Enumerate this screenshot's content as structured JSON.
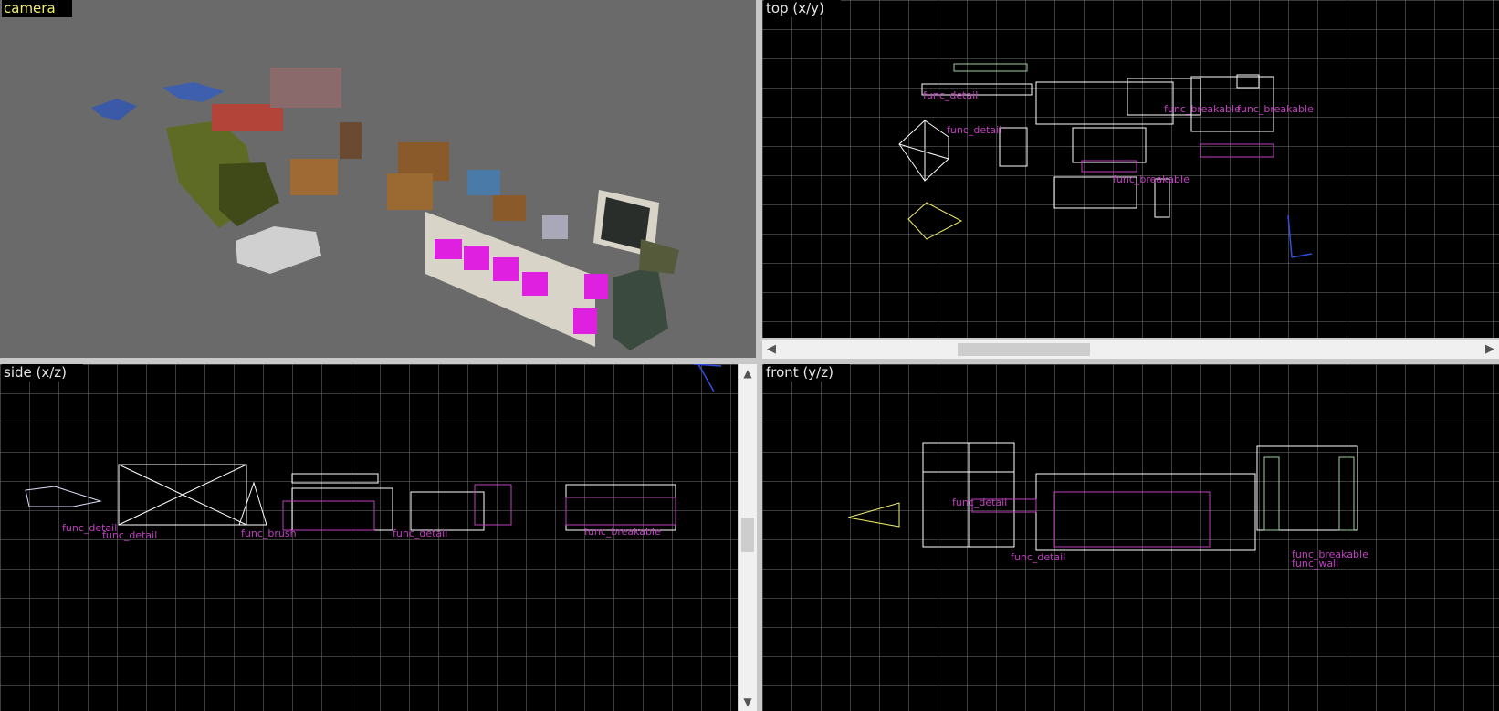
{
  "viewports": {
    "camera": {
      "label": "camera"
    },
    "top": {
      "label": "top (x/y)"
    },
    "side": {
      "label": "side (x/z)"
    },
    "front": {
      "label": "front (y/z)"
    }
  },
  "entity_labels": {
    "top": [
      "func_detail",
      "func_breakable",
      "func_detail",
      "func_breakable",
      "func_breakable"
    ],
    "side": [
      "func_detail",
      "func_detail",
      "func_brush",
      "func_detail",
      "func_breakable"
    ],
    "front": [
      "func_detail",
      "func_detail",
      "func_breakable",
      "func_wall"
    ]
  },
  "colors": {
    "camera_bg": "#6a6a6a",
    "grid_bg": "#000000",
    "grid_line": "#6e6e6e",
    "brush_white": "#ffffff",
    "entity_magenta": "#c040c0",
    "label_yellow": "#f2ef6a"
  },
  "icons": {
    "scroll_left": "◀",
    "scroll_right": "▶",
    "scroll_up": "▲",
    "scroll_down": "▼"
  }
}
